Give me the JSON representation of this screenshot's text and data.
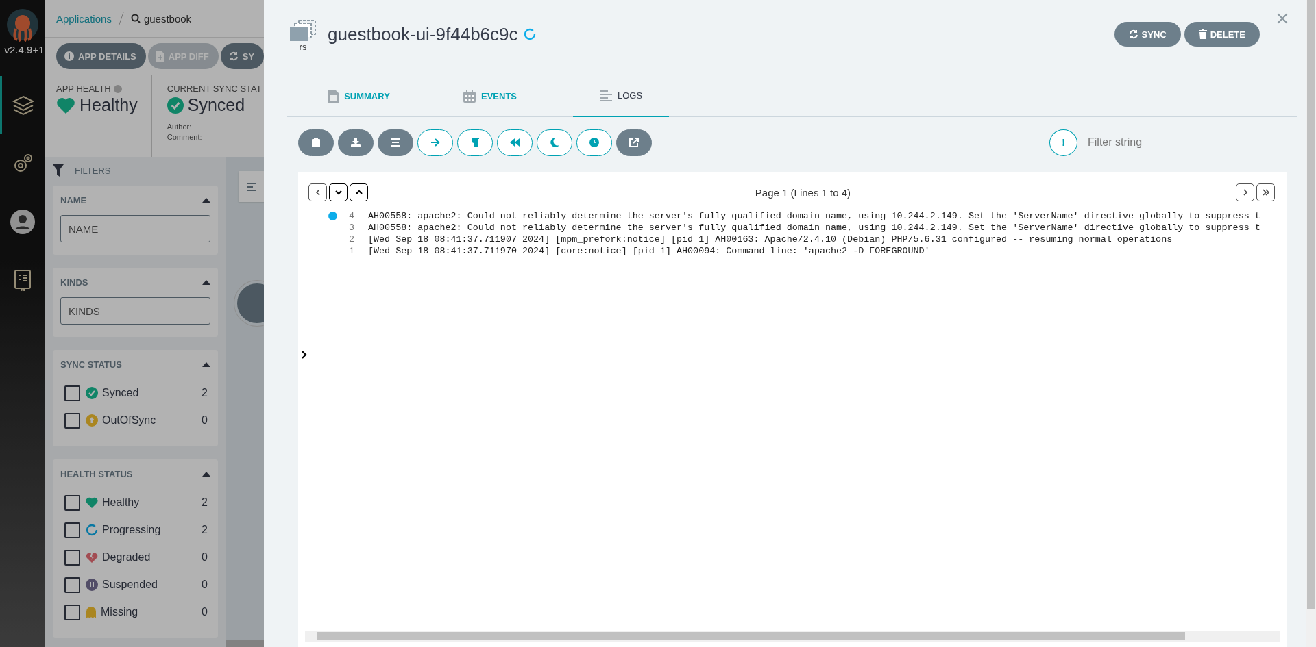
{
  "nav": {
    "version": "v2.4.9+1",
    "items": [
      {
        "kind": "applications",
        "selected": true
      },
      {
        "kind": "settings",
        "selected": false
      },
      {
        "kind": "user",
        "selected": false
      },
      {
        "kind": "docs",
        "selected": false
      }
    ]
  },
  "breadcrumb": {
    "root": "Applications",
    "search": "guestbook"
  },
  "toolbar": [
    {
      "kind": "details",
      "label": "APP DETAILS",
      "disabled": false
    },
    {
      "kind": "diff",
      "label": "APP DIFF",
      "disabled": true
    },
    {
      "kind": "sync",
      "label": "SY",
      "disabled": false
    }
  ],
  "summary": {
    "app_health": {
      "label": "APP HEALTH",
      "value": "Healthy"
    },
    "sync_status": {
      "label": "CURRENT SYNC STAT",
      "value": "Synced",
      "author_label": "Author:",
      "comment_label": "Comment:"
    }
  },
  "filters": {
    "title": "FILTERS",
    "name": {
      "title": "NAME",
      "placeholder": "NAME"
    },
    "kinds": {
      "title": "KINDS",
      "placeholder": "KINDS"
    },
    "sync_status": {
      "title": "SYNC STATUS",
      "items": [
        {
          "kind": "synced",
          "label": "Synced",
          "count": "2",
          "checked": false
        },
        {
          "kind": "outofsync",
          "label": "OutOfSync",
          "count": "0",
          "checked": false
        }
      ]
    },
    "health_status": {
      "title": "HEALTH STATUS",
      "items": [
        {
          "kind": "healthy",
          "label": "Healthy",
          "count": "2",
          "checked": false
        },
        {
          "kind": "progressing",
          "label": "Progressing",
          "count": "2",
          "checked": false
        },
        {
          "kind": "degraded",
          "label": "Degraded",
          "count": "0",
          "checked": false
        },
        {
          "kind": "suspended",
          "label": "Suspended",
          "count": "0",
          "checked": false
        },
        {
          "kind": "missing",
          "label": "Missing",
          "count": "0",
          "checked": false
        }
      ]
    }
  },
  "panel": {
    "kind_label": "rs",
    "title": "guestbook-ui-9f44b6c9c",
    "actions": [
      {
        "kind": "sync",
        "label": "SYNC"
      },
      {
        "kind": "delete",
        "label": "DELETE"
      }
    ],
    "tabs": [
      {
        "kind": "summary",
        "label": "SUMMARY",
        "selected": false
      },
      {
        "kind": "events",
        "label": "EVENTS",
        "selected": false
      },
      {
        "kind": "logs",
        "label": "LOGS",
        "selected": true
      }
    ],
    "log_tools": [
      {
        "kind": "copy",
        "on": true
      },
      {
        "kind": "download",
        "on": true
      },
      {
        "kind": "wrap",
        "on": true
      },
      {
        "kind": "follow",
        "on": false
      },
      {
        "kind": "pilcrow",
        "on": false
      },
      {
        "kind": "rewind",
        "on": false
      },
      {
        "kind": "dark",
        "on": false
      },
      {
        "kind": "time",
        "on": false
      },
      {
        "kind": "external",
        "on": true
      }
    ],
    "filter": {
      "exclude_label": "!",
      "placeholder": "Filter string"
    },
    "log": {
      "page": "Page 1 (Lines 1 to 4)",
      "lines": [
        {
          "number": "4",
          "text": "AH00558: apache2: Could not reliably determine the server's fully qualified domain name, using 10.244.2.149. Set the 'ServerName' directive globally to suppress t",
          "marked": true
        },
        {
          "number": "3",
          "text": "AH00558: apache2: Could not reliably determine the server's fully qualified domain name, using 10.244.2.149. Set the 'ServerName' directive globally to suppress t",
          "marked": false
        },
        {
          "number": "2",
          "text": "[Wed Sep 18 08:41:37.711907 2024] [mpm_prefork:notice] [pid 1] AH00163: Apache/2.4.10 (Debian) PHP/5.6.31 configured -- resuming normal operations",
          "marked": false
        },
        {
          "number": "1",
          "text": "[Wed Sep 18 08:41:37.711970 2024] [core:notice] [pid 1] AH00094: Command line: 'apache2 -D FOREGROUND'",
          "marked": false
        }
      ]
    }
  }
}
